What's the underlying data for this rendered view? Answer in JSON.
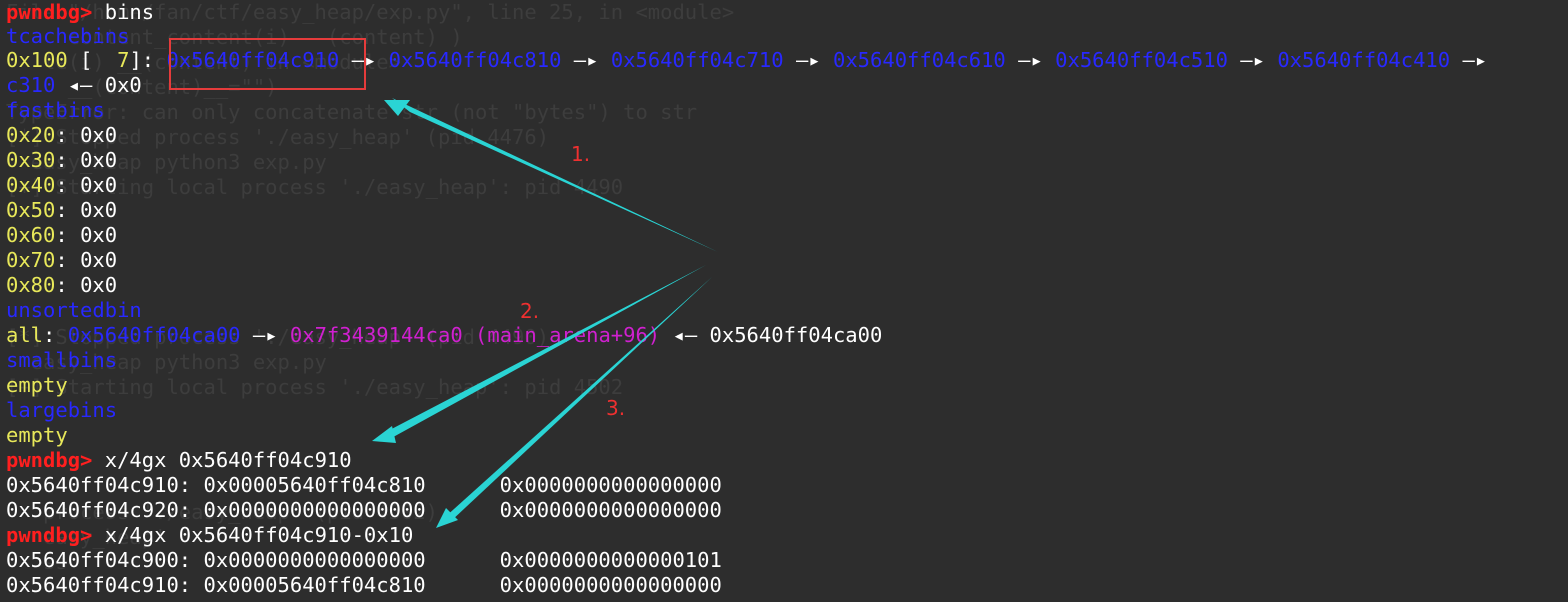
{
  "ghost_lines": [
    "File \"/home/fan/ctf/easy_heap/exp.py\", line 25, in <module>",
    "     content_content(i)   (content) )",
    "   le(i) __(content) in <module>",
    "     __(content)__=\"\")",
    "TypeError: can only concatenate str (not \"bytes\") to str",
    "[*] Stopped process './easy_heap' (pid 4476)",
    "  easy_heap python3 exp.py",
    "[+] Starting local process './easy_heap': pid 4490",
    "",
    "",
    "",
    "",
    "",
    "[*] Stopped process './easy_heap' (pid 4490)",
    "  easy_heap python3 exp.py",
    "[+] Starting local process './easy_heap': pid 4502",
    "",
    "",
    "",
    "",
    "   process './easy_heap' (pid 4502)",
    "   easy_heap'",
    "   ss"
  ],
  "terminal": {
    "line1": {
      "prompt": "pwndbg> ",
      "command": "bins"
    },
    "line2": {
      "section": "tcachebins"
    },
    "line3": {
      "size": "0x100",
      "bracket_open": " [",
      "count": "  7",
      "bracket_close": "]: ",
      "chain": [
        "0x5640ff04c910",
        "0x5640ff04c810",
        "0x5640ff04c710",
        "0x5640ff04c610",
        "0x5640ff04c510",
        "0x5640ff04c410"
      ],
      "arrow": " —▸ ",
      "trailing_arrow": " —▸"
    },
    "line4": {
      "addr": "c310",
      "arrow": " ◂— ",
      "value": "0x0"
    },
    "line5": {
      "section": "fastbins"
    },
    "fastbins": [
      {
        "size": "0x20",
        "sep": ": ",
        "value": "0x0"
      },
      {
        "size": "0x30",
        "sep": ": ",
        "value": "0x0"
      },
      {
        "size": "0x40",
        "sep": ": ",
        "value": "0x0"
      },
      {
        "size": "0x50",
        "sep": ": ",
        "value": "0x0"
      },
      {
        "size": "0x60",
        "sep": ": ",
        "value": "0x0"
      },
      {
        "size": "0x70",
        "sep": ": ",
        "value": "0x0"
      },
      {
        "size": "0x80",
        "sep": ": ",
        "value": "0x0"
      }
    ],
    "unsorted_header": "unsortedbin",
    "unsorted": {
      "label": "all",
      "sep": ": ",
      "addr1": "0x5640ff04ca00",
      "arrow1": " —▸ ",
      "addr2": "0x7f3439144ca0 (main_arena+96)",
      "arrow2": " ◂— ",
      "addr3": "0x5640ff04ca00"
    },
    "small_header": "smallbins",
    "small_value": "empty",
    "large_header": "largebins",
    "large_value": "empty",
    "cmd2": {
      "prompt": "pwndbg> ",
      "command": "x/4gx 0x5640ff04c910"
    },
    "mem1": [
      "0x5640ff04c910: 0x00005640ff04c810      0x0000000000000000",
      "0x5640ff04c920: 0x0000000000000000      0x0000000000000000"
    ],
    "cmd3": {
      "prompt": "pwndbg> ",
      "command": "x/4gx 0x5640ff04c910-0x10"
    },
    "mem2": [
      "0x5640ff04c900: 0x0000000000000000      0x0000000000000101",
      "0x5640ff04c910: 0x00005640ff04c810      0x0000000000000000"
    ]
  },
  "annotations": {
    "step1": "1.",
    "step2": "2.",
    "step3": "3.",
    "box_color": "#e53b3b",
    "arrow_color": "#2ad4d4",
    "label_color": "#ee3030"
  },
  "colors": {
    "background": "#2d2d2d",
    "prompt": "#ff1f1f",
    "address": "#2828ff",
    "size": "#e8e85a",
    "arena": "#d020d0"
  }
}
